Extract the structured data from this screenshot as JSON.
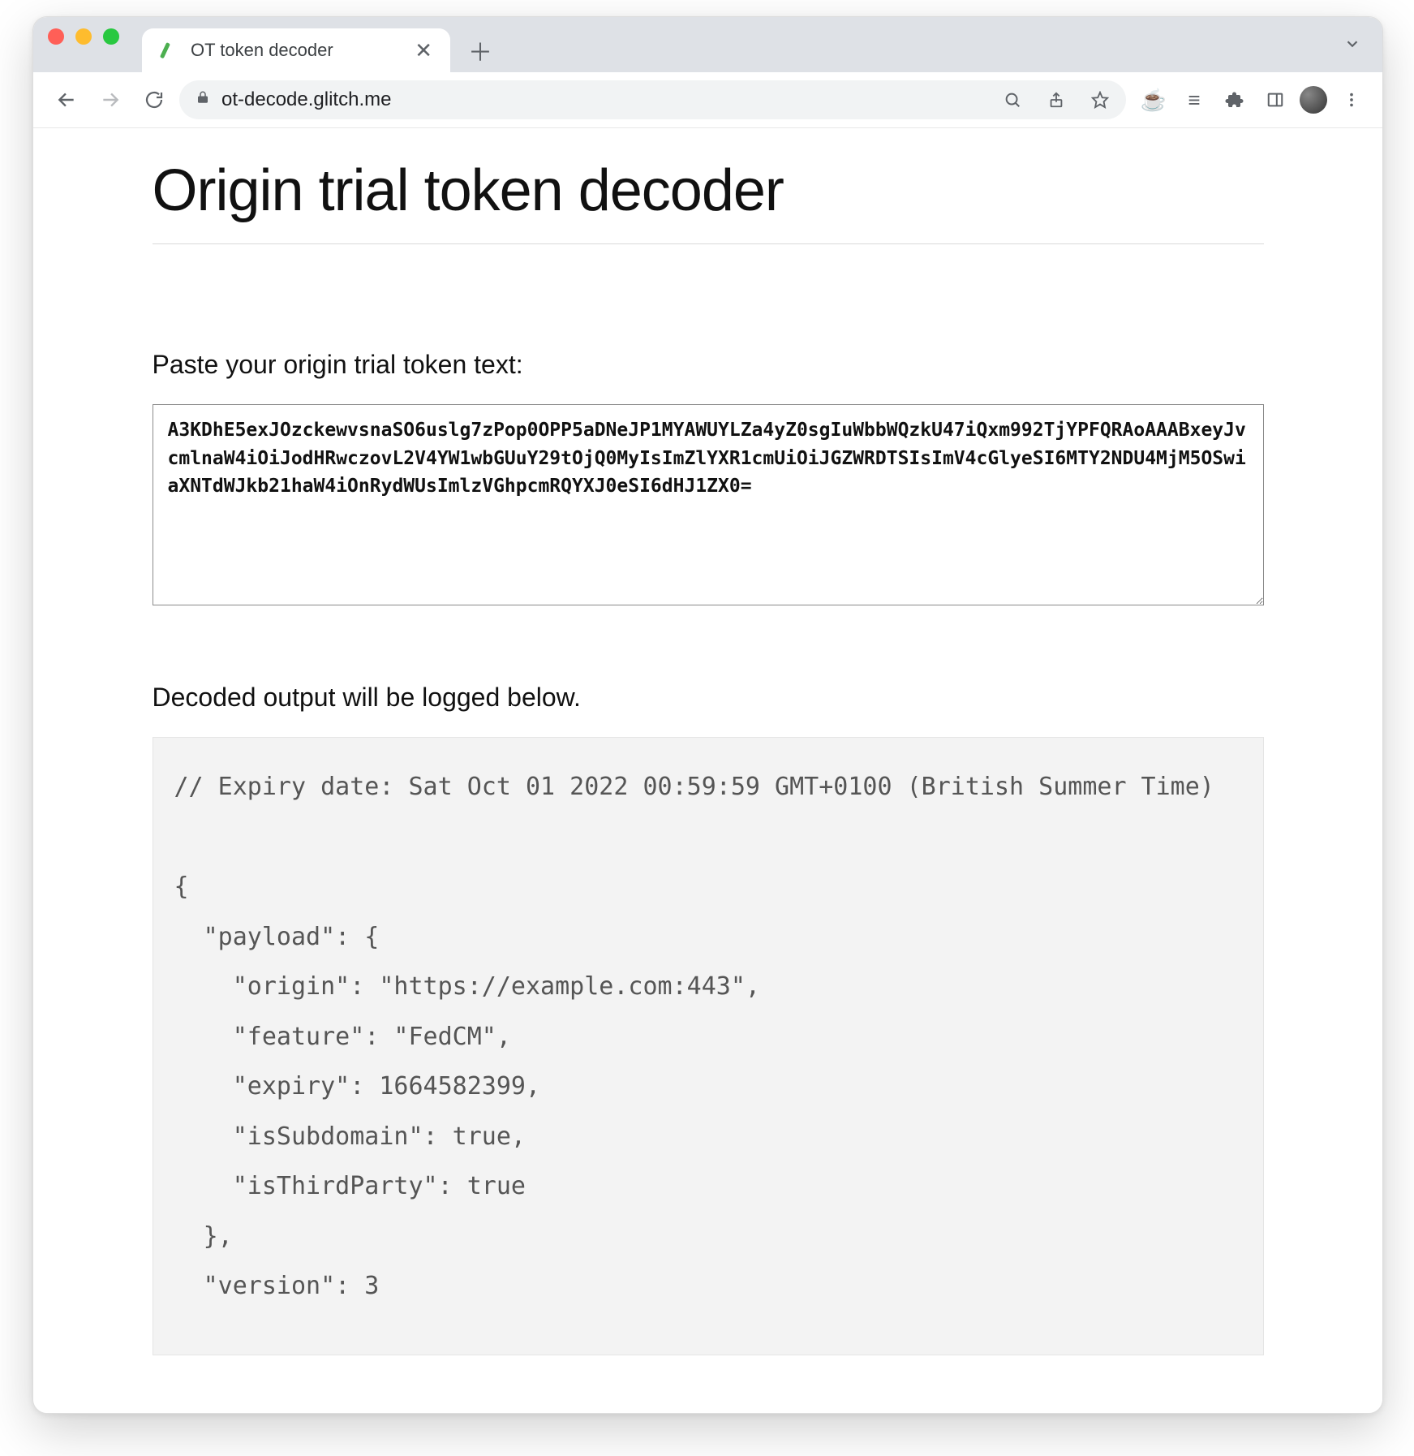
{
  "browser": {
    "tab": {
      "title": "OT token decoder",
      "favicon_color": "#4caf50"
    },
    "url": "ot-decode.glitch.me"
  },
  "page": {
    "title": "Origin trial token decoder",
    "input_label": "Paste your origin trial token text:",
    "token_text": "A3KDhE5exJOzckewvsnaSO6uslg7zPop0OPP5aDNeJP1MYAWUYLZa4yZ0sgIuWbbWQzkU47iQxm992TjYPFQRAoAAABxeyJvcmlnaW4iOiJodHRwczovL2V4YW1wbGUuY29tOjQ0MyIsImZlYXR1cmUiOiJGZWRDTSIsImV4cGlyeSI6MTY2NDU4MjM5OSwiaXNTdWJkb21haW4iOnRydWUsImlzVGhpcmRQYXJ0eSI6dHJ1ZX0=",
    "output_label": "Decoded output will be logged below.",
    "output_text": "// Expiry date: Sat Oct 01 2022 00:59:59 GMT+0100 (British Summer Time)\n\n{\n  \"payload\": {\n    \"origin\": \"https://example.com:443\",\n    \"feature\": \"FedCM\",\n    \"expiry\": 1664582399,\n    \"isSubdomain\": true,\n    \"isThirdParty\": true\n  },\n  \"version\": 3"
  }
}
